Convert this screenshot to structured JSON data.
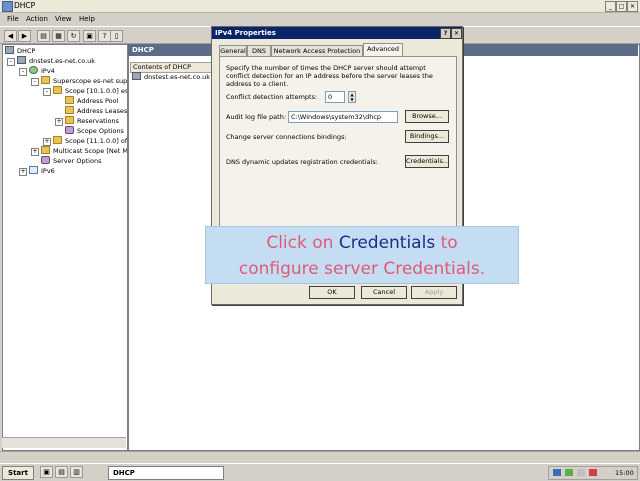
{
  "window": {
    "title": "DHCP"
  },
  "menu": [
    "File",
    "Action",
    "View",
    "Help"
  ],
  "tree": {
    "root": "DHCP",
    "server": "dnstest.es-net.co.uk",
    "ipv4": "IPv4",
    "superscope": "Superscope es-net supe",
    "scope1": "Scope [10.1.0.0] es",
    "address_pool": "Address Pool",
    "address_leases": "Address Leases",
    "reservations": "Reservations",
    "scope_options": "Scope Options",
    "scope2": "Scope [11.1.0.0] of",
    "multicast": "Multicast Scope [Net Me",
    "server_options": "Server Options",
    "ipv6": "IPv6"
  },
  "right_pane": {
    "header": "DHCP",
    "column": "Contents of DHCP",
    "item": "dnstest.es-net.co.uk"
  },
  "dialog": {
    "title": "IPv4 Properties",
    "tabs": [
      "General",
      "DNS",
      "Network Access Protection",
      "Advanced"
    ],
    "description": "Specify the number of times the DHCP server should attempt conflict detection for an IP address before the server leases the address to a client.",
    "conflict_label": "Conflict detection attempts:",
    "conflict_value": "0",
    "audit_label": "Audit log file path:",
    "audit_value": "C:\\Windows\\system32\\dhcp",
    "browse": "Browse...",
    "bindings_label": "Change server connections bindings:",
    "bindings": "Bindings...",
    "credentials_label": "DNS dynamic updates registration credentials:",
    "credentials": "Credentials...",
    "ok": "OK",
    "cancel": "Cancel",
    "apply": "Apply"
  },
  "callout": {
    "part1": "Click on",
    "highlight": "Credentials",
    "part2": "to",
    "line2": "configure server Credentials."
  },
  "taskbar": {
    "start": "Start",
    "task": "DHCP",
    "clock": "15:00"
  },
  "colors": {
    "dialog_title": "#0a246a",
    "callout_bg": "#c5ddf2",
    "callout_red": "#e05a78",
    "callout_blue": "#1c2e86"
  }
}
